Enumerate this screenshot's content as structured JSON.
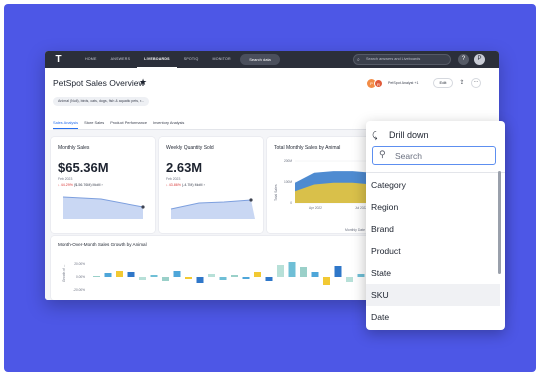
{
  "topbar": {
    "logo": "T",
    "nav": [
      "HOME",
      "ANSWERS",
      "LIVEBOARDS",
      "SPOTIQ",
      "MONITOR",
      "DATA"
    ],
    "active_nav": "LIVEBOARDS",
    "search_data_label": "Search data",
    "global_search_placeholder": "Search answers and Liveboards",
    "help_label": "?",
    "user_initial": "P"
  },
  "header": {
    "title": "PetSpot Sales Overview",
    "filter_chip": "Animal (Null), birds, cats, dogs, fish & aquatic pets, r...",
    "owner_label": "PetSpot Analyst +1",
    "avatar_a": "P",
    "avatar_b": "R",
    "edit_label": "Edit"
  },
  "tabs": [
    "Sales Analysis",
    "Store Sales",
    "Product Performance",
    "Inventory Analysis"
  ],
  "cards": {
    "monthly_sales": {
      "title": "Monthly Sales",
      "value": "$65.36M",
      "period": "Feb 2023",
      "change_pct": "↓ 44.29%",
      "change_detail": "($-56.76M) MoM",
      "arrow": "›"
    },
    "weekly_quantity": {
      "title": "Weekly Quantity Sold",
      "value": "2.63M",
      "period": "Feb 2023",
      "change_pct": "↓ 43.86%",
      "change_detail": "(-4.7M) MoM",
      "arrow": "›"
    },
    "total_monthly": {
      "title": "Total Monthly Sales by Animal"
    },
    "growth": {
      "title": "Month-Over-Month Sales Growth by Animal"
    }
  },
  "chart_data": [
    {
      "type": "area",
      "title": "Total Monthly Sales by Animal",
      "ylabel": "Total Sales",
      "xlabel": "Monthly Date",
      "x": [
        "Apr 2022",
        "Jul 2022"
      ],
      "yticks": [
        "200M",
        "100M",
        "0"
      ],
      "series": [
        {
          "name": "",
          "color": "#2f77c9",
          "values": [
            60,
            90,
            95,
            95,
            90,
            70
          ]
        },
        {
          "name": "",
          "color": "#f2c933",
          "values": [
            35,
            55,
            60,
            60,
            55,
            45
          ]
        }
      ]
    },
    {
      "type": "bar",
      "title": "Month-Over-Month Sales Growth by Animal",
      "ylabel": "Growth of ...",
      "yticks": [
        "20.00%",
        "0.00%",
        "-20.00%"
      ],
      "values": [
        1,
        4,
        6,
        5,
        -3,
        2,
        -4,
        6,
        -2,
        -6,
        3,
        -3,
        2,
        -2,
        5,
        -4,
        12,
        15,
        10,
        5,
        -8,
        11,
        -5,
        3,
        -3,
        2
      ]
    }
  ],
  "colors": {
    "backdrop": "#4d57e6",
    "accent": "#2770ef",
    "down": "#d93b3b"
  },
  "dropdown": {
    "title": "Drill down",
    "back_icon": "back-arrow-icon",
    "search_placeholder": "Search",
    "items": [
      "Category",
      "Region",
      "Brand",
      "Product",
      "State",
      "SKU",
      "Date"
    ],
    "hovered": "SKU"
  }
}
